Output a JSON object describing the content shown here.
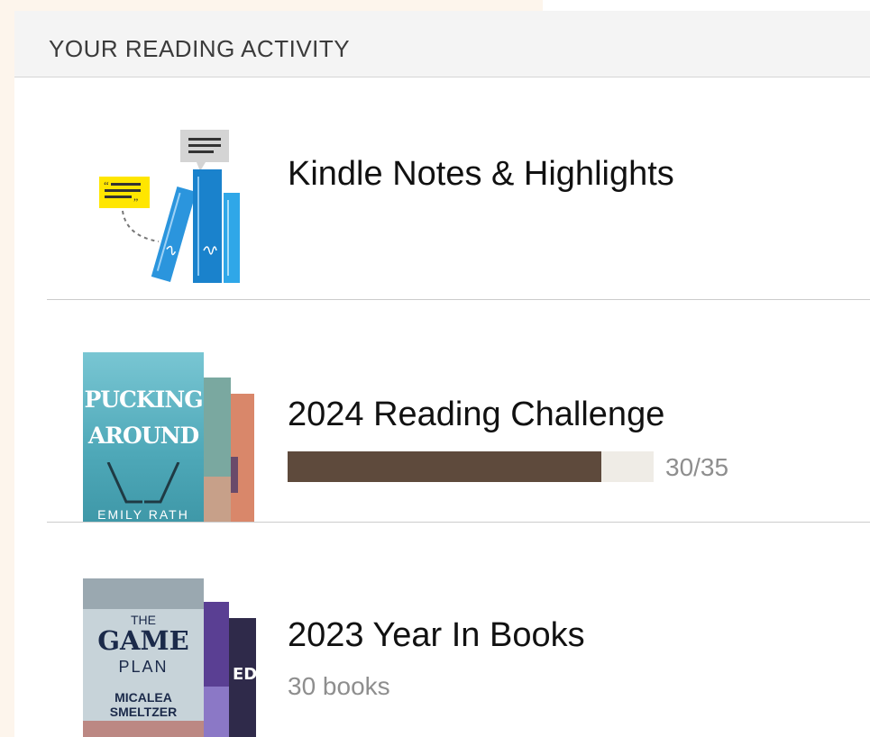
{
  "section": {
    "title": "YOUR READING ACTIVITY"
  },
  "notes_row": {
    "title": "Kindle Notes & Highlights",
    "icon": "books-notes-highlights-icon"
  },
  "challenge_row": {
    "title": "2024 Reading Challenge",
    "progress": {
      "current": 30,
      "goal": 35,
      "fraction": 0.857,
      "label": "30/35"
    },
    "covers": [
      {
        "title_line1": "PUCKING",
        "title_line2": "AROUND",
        "author": "EMILY RATH",
        "color": "#5fb7c6"
      },
      {
        "color": "#7aa8a0"
      },
      {
        "color": "#d9876a"
      }
    ]
  },
  "year_row": {
    "title": "2023 Year In Books",
    "subtitle": "30 books",
    "covers": [
      {
        "title_line1": "THE",
        "title_line2": "GAME",
        "title_line3": "PLAN",
        "author_line1": "MICALEA",
        "author_line2": "SMELTZER",
        "color": "#c7d3d9"
      },
      {
        "color": "#5a3f93"
      },
      {
        "color": "#2f2a4a"
      }
    ]
  },
  "colors": {
    "progress_fill": "#5e4a3c",
    "progress_track": "#efece6",
    "accent_blue": "#1f8ad6",
    "highlight_yellow": "#ffe600"
  }
}
